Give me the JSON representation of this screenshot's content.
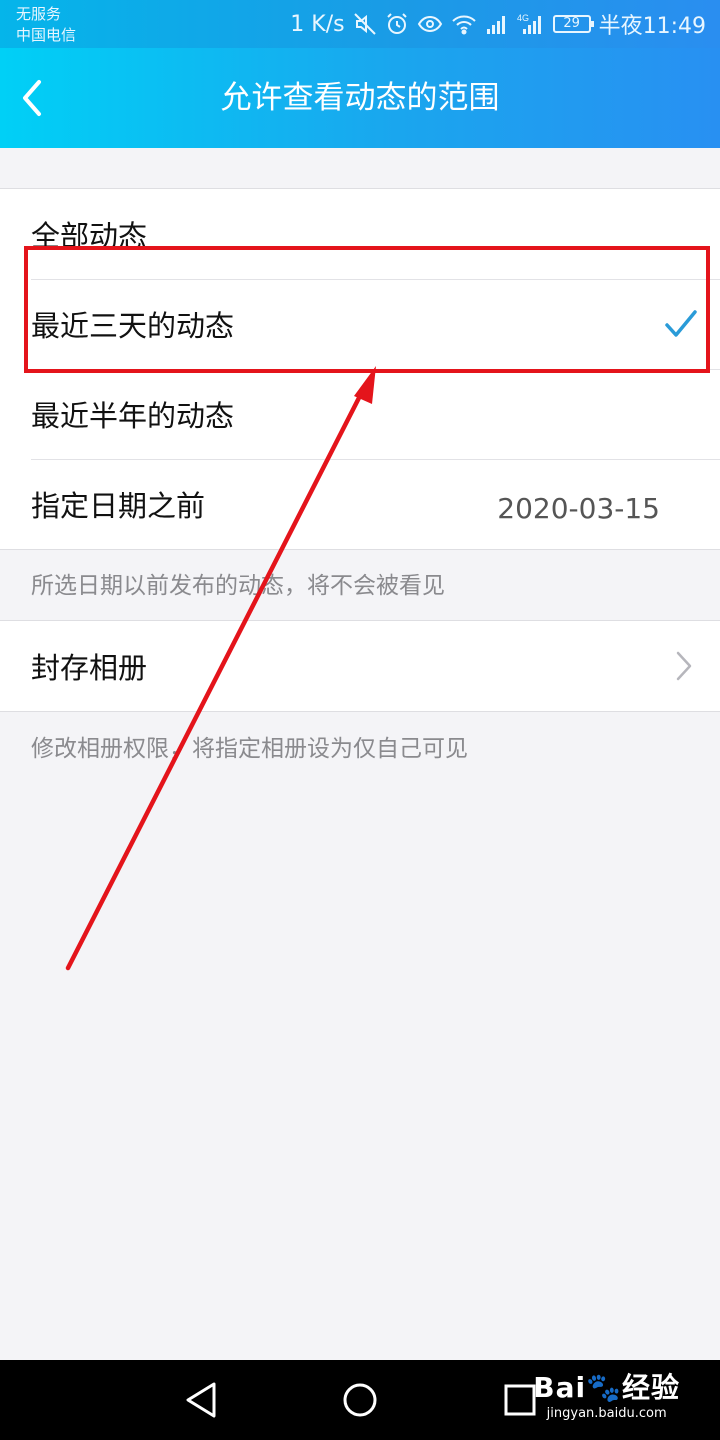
{
  "status_bar": {
    "carrier_line1": "无服务",
    "carrier_line2": "中国电信",
    "net_speed": "1 K/s",
    "battery": "29",
    "time": "半夜11:49"
  },
  "header": {
    "title": "允许查看动态的范围"
  },
  "range_options": [
    {
      "label": "全部动态",
      "selected": false
    },
    {
      "label": "最近三天的动态",
      "selected": true
    },
    {
      "label": "最近半年的动态",
      "selected": false
    },
    {
      "label": "指定日期之前",
      "value": "2020-03-15",
      "selected": false
    }
  ],
  "date_note": "所选日期以前发布的动态，将不会被看见",
  "album": {
    "label": "封存相册",
    "note": "修改相册权限，将指定相册设为仅自己可见"
  },
  "watermark": {
    "logo": "Bai🐾经验",
    "url": "jingyan.baidu.com"
  },
  "colors": {
    "accent": "#1aa6ee",
    "annotation": "#e4141b",
    "check": "#2a9bd8"
  }
}
